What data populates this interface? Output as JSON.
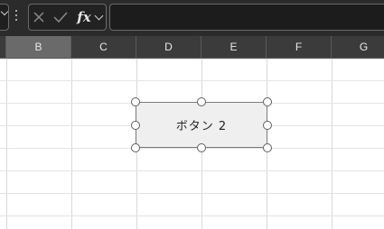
{
  "formula_bar": {
    "name_box_value": "",
    "fx_label": "fx",
    "formula_value": ""
  },
  "columns": [
    {
      "label": ""
    },
    {
      "label": "B",
      "selected": true
    },
    {
      "label": "C"
    },
    {
      "label": "D"
    },
    {
      "label": "E"
    },
    {
      "label": "F"
    },
    {
      "label": "G"
    }
  ],
  "form_button": {
    "label": "ボタン 2",
    "selected": true
  },
  "colors": {
    "ribbon_bg": "#2b2b2b",
    "header_bg": "#3b3b3b",
    "header_selected_bg": "#6a6a6a",
    "gridline": "#d9d9d9",
    "button_fill": "#efefef"
  }
}
